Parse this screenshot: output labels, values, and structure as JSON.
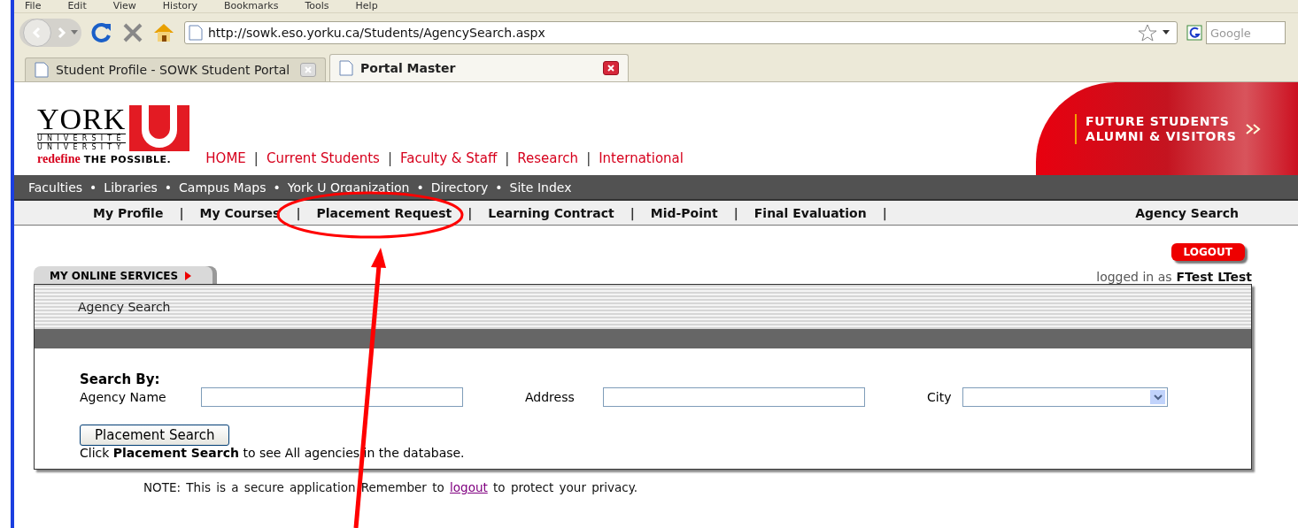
{
  "menu": [
    "File",
    "Edit",
    "View",
    "History",
    "Bookmarks",
    "Tools",
    "Help"
  ],
  "address": "http://sowk.eso.yorku.ca/Students/AgencySearch.aspx",
  "search": {
    "placeholder": "Google"
  },
  "tabs": [
    {
      "title": "Student Profile - SOWK Student Portal",
      "selected": false
    },
    {
      "title": "Portal Master",
      "selected": true
    }
  ],
  "logo": {
    "mark": "YORK",
    "line_1": "UNIVERSITÉ",
    "line_2": "UNIVERSITY",
    "tagline_1": "redefine",
    "tagline_2": "THE POSSIBLE."
  },
  "top_links_separator": "|",
  "utility_separator": "•",
  "nav_separator": "|",
  "top_links": [
    "HOME",
    "Current Students",
    "Faculty & Staff",
    "Research",
    "International"
  ],
  "banner": {
    "line_1": "FUTURE STUDENTS",
    "line_2": "ALUMNI & VISITORS"
  },
  "utility_links": [
    "Faculties",
    "Libraries",
    "Campus Maps",
    "York U Organization",
    "Directory",
    "Site Index"
  ],
  "nav": [
    "My Profile",
    "My Courses",
    "Placement Request",
    "Learning Contract",
    "Mid-Point",
    "Final Evaluation"
  ],
  "nav_right": "Agency Search",
  "logout": "LOGOUT",
  "logged_in": {
    "prefix": "logged in as",
    "user": "FTest LTest"
  },
  "services_tab": "MY ONLINE SERVICES",
  "panel_title": "Agency Search",
  "search_by": "Search By:",
  "fields": [
    {
      "label": "Agency Name",
      "kind": "text"
    },
    {
      "label": "Address",
      "kind": "text"
    },
    {
      "label": "City",
      "kind": "select"
    }
  ],
  "search_button": "Placement Search",
  "hint": "Click **Placement Search** to see All agencies in the database.",
  "note": {
    "before": "NOTE: This is a secure application Remember to",
    "link": "logout",
    "after": "to protect your privacy."
  }
}
